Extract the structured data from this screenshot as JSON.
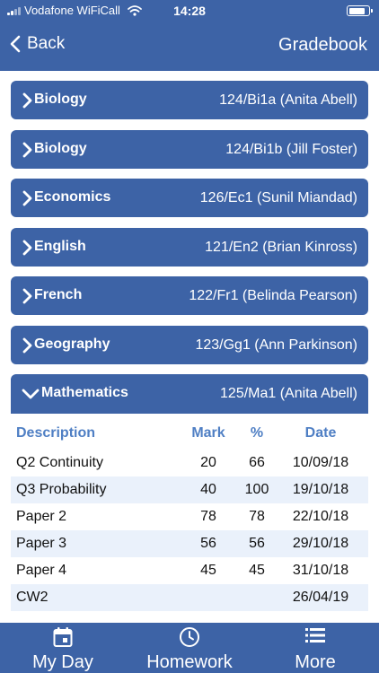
{
  "status": {
    "carrier": "Vodafone WiFiCall",
    "time": "14:28",
    "battery_level": 0.85
  },
  "nav": {
    "back_label": "Back",
    "title": "Gradebook"
  },
  "subjects": [
    {
      "name": "Biology",
      "group": "124/Bi1a (Anita Abell)"
    },
    {
      "name": "Biology",
      "group": "124/Bi1b (Jill Foster)"
    },
    {
      "name": "Economics",
      "group": "126/Ec1 (Sunil Miandad)"
    },
    {
      "name": "English",
      "group": "121/En2 (Brian Kinross)"
    },
    {
      "name": "French",
      "group": "122/Fr1 (Belinda Pearson)"
    },
    {
      "name": "Geography",
      "group": "123/Gg1 (Ann Parkinson)"
    },
    {
      "name": "Mathematics",
      "group": "125/Ma1 (Anita Abell)"
    }
  ],
  "grades": {
    "headers": {
      "description": "Description",
      "mark": "Mark",
      "percent": "%",
      "date": "Date"
    },
    "rows": [
      {
        "description": "Q2  Continuity",
        "mark": "20",
        "percent": "66",
        "date": "10/09/18"
      },
      {
        "description": "Q3 Probability",
        "mark": "40",
        "percent": "100",
        "date": "19/10/18"
      },
      {
        "description": "Paper 2",
        "mark": "78",
        "percent": "78",
        "date": "22/10/18"
      },
      {
        "description": "Paper 3",
        "mark": "56",
        "percent": "56",
        "date": "29/10/18"
      },
      {
        "description": "Paper 4",
        "mark": "45",
        "percent": "45",
        "date": "31/10/18"
      },
      {
        "description": "CW2",
        "mark": "",
        "percent": "",
        "date": "26/04/19"
      }
    ]
  },
  "tabs": {
    "my_day": "My Day",
    "homework": "Homework",
    "more": "More"
  },
  "colors": {
    "brand_blue": "#3d63a6",
    "header_text": "#4f7fc4",
    "row_alt": "#eaf1fb"
  }
}
